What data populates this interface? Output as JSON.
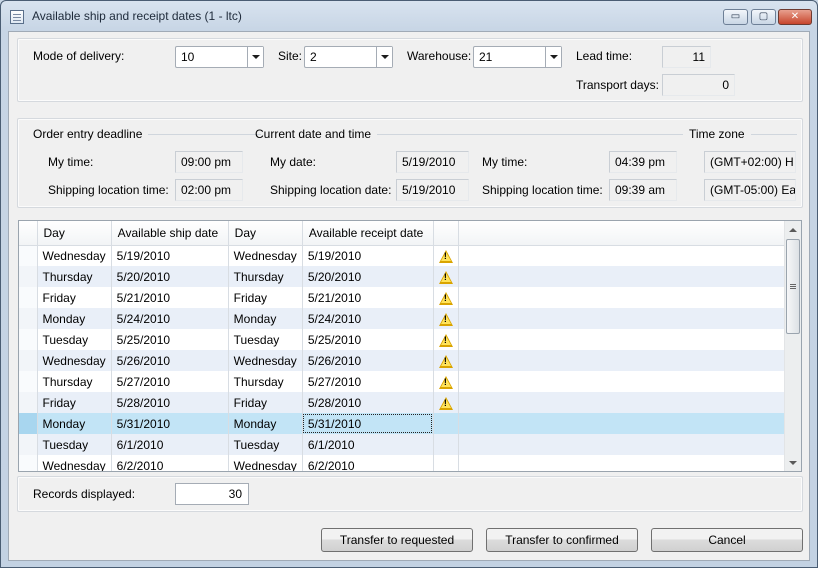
{
  "window": {
    "title": "Available ship and receipt dates (1 - ltc)",
    "minimize_glyph": "▭",
    "maximize_glyph": "▢",
    "close_glyph": "✕"
  },
  "delivery": {
    "mode_label": "Mode of delivery:",
    "mode_value": "10",
    "site_label": "Site:",
    "site_value": "2",
    "warehouse_label": "Warehouse:",
    "warehouse_value": "21",
    "lead_time_label": "Lead time:",
    "lead_time_value": "11",
    "transport_days_label": "Transport days:",
    "transport_days_value": "0"
  },
  "deadline": {
    "section_title": "Order entry deadline",
    "my_time_label": "My time:",
    "my_time_value": "09:00 pm",
    "shipping_time_label": "Shipping location time:",
    "shipping_time_value": "02:00 pm"
  },
  "current": {
    "section_title": "Current date and time",
    "my_date_label": "My date:",
    "my_date_value": "5/19/2010",
    "shipping_date_label": "Shipping location date:",
    "shipping_date_value": "5/19/2010",
    "my_time_label": "My time:",
    "my_time_value": "04:39 pm",
    "shipping_time_label": "Shipping location time:",
    "shipping_time_value": "09:39 am"
  },
  "timezone": {
    "section_title": "Time zone",
    "my_zone": "(GMT+02:00) H",
    "shipping_zone": "(GMT-05:00) Ea"
  },
  "grid": {
    "columns": [
      "Day",
      "Available ship date",
      "Day",
      "Available receipt date"
    ],
    "rows": [
      {
        "ship_day": "Wednesday",
        "ship_date": "5/19/2010",
        "receipt_day": "Wednesday",
        "receipt_date": "5/19/2010",
        "warning": true
      },
      {
        "ship_day": "Thursday",
        "ship_date": "5/20/2010",
        "receipt_day": "Thursday",
        "receipt_date": "5/20/2010",
        "warning": true
      },
      {
        "ship_day": "Friday",
        "ship_date": "5/21/2010",
        "receipt_day": "Friday",
        "receipt_date": "5/21/2010",
        "warning": true
      },
      {
        "ship_day": "Monday",
        "ship_date": "5/24/2010",
        "receipt_day": "Monday",
        "receipt_date": "5/24/2010",
        "warning": true
      },
      {
        "ship_day": "Tuesday",
        "ship_date": "5/25/2010",
        "receipt_day": "Tuesday",
        "receipt_date": "5/25/2010",
        "warning": true
      },
      {
        "ship_day": "Wednesday",
        "ship_date": "5/26/2010",
        "receipt_day": "Wednesday",
        "receipt_date": "5/26/2010",
        "warning": true
      },
      {
        "ship_day": "Thursday",
        "ship_date": "5/27/2010",
        "receipt_day": "Thursday",
        "receipt_date": "5/27/2010",
        "warning": true
      },
      {
        "ship_day": "Friday",
        "ship_date": "5/28/2010",
        "receipt_day": "Friday",
        "receipt_date": "5/28/2010",
        "warning": true
      },
      {
        "ship_day": "Monday",
        "ship_date": "5/31/2010",
        "receipt_day": "Monday",
        "receipt_date": "5/31/2010",
        "warning": false
      },
      {
        "ship_day": "Tuesday",
        "ship_date": "6/1/2010",
        "receipt_day": "Tuesday",
        "receipt_date": "6/1/2010",
        "warning": false
      },
      {
        "ship_day": "Wednesday",
        "ship_date": "6/2/2010",
        "receipt_day": "Wednesday",
        "receipt_date": "6/2/2010",
        "warning": false
      }
    ],
    "selected_row_index": 8
  },
  "records": {
    "label": "Records displayed:",
    "value": "30"
  },
  "buttons": {
    "transfer_requested": "Transfer to requested",
    "transfer_confirmed": "Transfer to confirmed",
    "cancel": "Cancel"
  },
  "icons": {
    "warning": "warning-icon"
  },
  "colors": {
    "title_bar": "#c7d5e5",
    "selected_row": "#c2e4f6",
    "alt_row": "#e9eff8",
    "warning": "#d9a400"
  }
}
